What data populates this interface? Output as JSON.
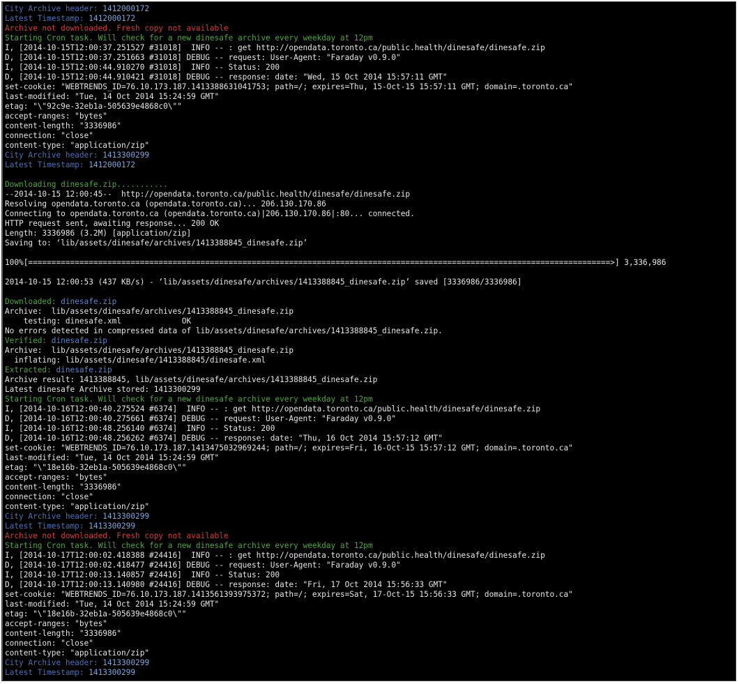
{
  "colors": {
    "background": "#000000",
    "plain": "#e6e6e6",
    "label_blue": "#4a6fb5",
    "value_blue": "#7fa6d9",
    "error_red": "#d23a3a",
    "info_green": "#4ea63b"
  },
  "lines": [
    [
      {
        "t": "City Archive header: ",
        "s": "label"
      },
      {
        "t": "1412000172",
        "s": "val"
      }
    ],
    [
      {
        "t": "Latest Timestamp: ",
        "s": "label"
      },
      {
        "t": "1412000172",
        "s": "val"
      }
    ],
    [
      {
        "t": "Archive not downloaded. Fresh copy not available",
        "s": "err"
      }
    ],
    [
      {
        "t": "Starting Cron task. Will check for a new dinesafe archive every weekday at 12pm",
        "s": "green"
      }
    ],
    [
      {
        "t": "I, [2014-10-15T12:00:37.251527 #31018]  INFO -- : get http://opendata.toronto.ca/public.health/dinesafe/dinesafe.zip",
        "s": "plain"
      }
    ],
    [
      {
        "t": "D, [2014-10-15T12:00:37.251663 #31018] DEBUG -- request: User-Agent: \"Faraday v0.9.0\"",
        "s": "plain"
      }
    ],
    [
      {
        "t": "I, [2014-10-15T12:00:44.910270 #31018]  INFO -- Status: 200",
        "s": "plain"
      }
    ],
    [
      {
        "t": "D, [2014-10-15T12:00:44.910421 #31018] DEBUG -- response: date: \"Wed, 15 Oct 2014 15:57:11 GMT\"",
        "s": "plain"
      }
    ],
    [
      {
        "t": "set-cookie: \"WEBTRENDS_ID=76.10.173.187.1413388631041753; path=/; expires=Thu, 15-Oct-15 15:57:11 GMT; domain=.toronto.ca\"",
        "s": "plain"
      }
    ],
    [
      {
        "t": "last-modified: \"Tue, 14 Oct 2014 15:24:59 GMT\"",
        "s": "plain"
      }
    ],
    [
      {
        "t": "etag: \"\\\"92c9e-32eb1a-505639e4868c0\\\"\"",
        "s": "plain"
      }
    ],
    [
      {
        "t": "accept-ranges: \"bytes\"",
        "s": "plain"
      }
    ],
    [
      {
        "t": "content-length: \"3336986\"",
        "s": "plain"
      }
    ],
    [
      {
        "t": "connection: \"close\"",
        "s": "plain"
      }
    ],
    [
      {
        "t": "content-type: \"application/zip\"",
        "s": "plain"
      }
    ],
    [
      {
        "t": "City Archive header: ",
        "s": "label"
      },
      {
        "t": "1413300299",
        "s": "val"
      }
    ],
    [
      {
        "t": "Latest Timestamp: ",
        "s": "label"
      },
      {
        "t": "1412000172",
        "s": "val"
      }
    ],
    [
      {
        "t": "",
        "s": "plain"
      }
    ],
    [
      {
        "t": "Downloading dinesafe.zip...........",
        "s": "green"
      }
    ],
    [
      {
        "t": "--2014-10-15 12:00:45--  http://opendata.toronto.ca/public.health/dinesafe/dinesafe.zip",
        "s": "plain"
      }
    ],
    [
      {
        "t": "Resolving opendata.toronto.ca (opendata.toronto.ca)... 206.130.170.86",
        "s": "plain"
      }
    ],
    [
      {
        "t": "Connecting to opendata.toronto.ca (opendata.toronto.ca)|206.130.170.86|:80... connected.",
        "s": "plain"
      }
    ],
    [
      {
        "t": "HTTP request sent, awaiting response... 200 OK",
        "s": "plain"
      }
    ],
    [
      {
        "t": "Length: 3336986 (3.2M) [application/zip]",
        "s": "plain"
      }
    ],
    [
      {
        "t": "Saving to: ‘lib/assets/dinesafe/archives/1413388845_dinesafe.zip’",
        "s": "plain"
      }
    ],
    [
      {
        "t": "",
        "s": "plain"
      }
    ],
    [
      {
        "t": "100%[=============================================================================================================================>] 3,336,986",
        "s": "plain"
      }
    ],
    [
      {
        "t": "",
        "s": "plain"
      }
    ],
    [
      {
        "t": "2014-10-15 12:00:53 (437 KB/s) - ‘lib/assets/dinesafe/archives/1413388845_dinesafe.zip’ saved [3336986/3336986]",
        "s": "plain"
      }
    ],
    [
      {
        "t": "",
        "s": "plain"
      }
    ],
    [
      {
        "t": "Downloaded: ",
        "s": "green"
      },
      {
        "t": "dinesafe.zip",
        "s": "file"
      }
    ],
    [
      {
        "t": "Archive:  lib/assets/dinesafe/archives/1413388845_dinesafe.zip",
        "s": "plain"
      }
    ],
    [
      {
        "t": "    testing: dinesafe.xml             OK",
        "s": "plain"
      }
    ],
    [
      {
        "t": "No errors detected in compressed data of lib/assets/dinesafe/archives/1413388845_dinesafe.zip.",
        "s": "plain"
      }
    ],
    [
      {
        "t": "Verified: ",
        "s": "green"
      },
      {
        "t": "dinesafe.zip",
        "s": "file"
      }
    ],
    [
      {
        "t": "Archive:  lib/assets/dinesafe/archives/1413388845_dinesafe.zip",
        "s": "plain"
      }
    ],
    [
      {
        "t": "  inflating: lib/assets/dinesafe/1413388845/dinesafe.xml",
        "s": "plain"
      }
    ],
    [
      {
        "t": "Extracted: ",
        "s": "green"
      },
      {
        "t": "dinesafe.zip",
        "s": "file"
      }
    ],
    [
      {
        "t": "Archive result: 1413388845, lib/assets/dinesafe/archives/1413388845_dinesafe.zip",
        "s": "plain"
      }
    ],
    [
      {
        "t": "Latest dinesafe Archive stored: 1413300299",
        "s": "plain"
      }
    ],
    [
      {
        "t": "Starting Cron task. Will check for a new dinesafe archive every weekday at 12pm",
        "s": "green"
      }
    ],
    [
      {
        "t": "I, [2014-10-16T12:00:40.275524 #6374]  INFO -- : get http://opendata.toronto.ca/public.health/dinesafe/dinesafe.zip",
        "s": "plain"
      }
    ],
    [
      {
        "t": "D, [2014-10-16T12:00:40.275661 #6374] DEBUG -- request: User-Agent: \"Faraday v0.9.0\"",
        "s": "plain"
      }
    ],
    [
      {
        "t": "I, [2014-10-16T12:00:48.256140 #6374]  INFO -- Status: 200",
        "s": "plain"
      }
    ],
    [
      {
        "t": "D, [2014-10-16T12:00:48.256262 #6374] DEBUG -- response: date: \"Thu, 16 Oct 2014 15:57:12 GMT\"",
        "s": "plain"
      }
    ],
    [
      {
        "t": "set-cookie: \"WEBTRENDS_ID=76.10.173.187.1413475032969244; path=/; expires=Fri, 16-Oct-15 15:57:12 GMT; domain=.toronto.ca\"",
        "s": "plain"
      }
    ],
    [
      {
        "t": "last-modified: \"Tue, 14 Oct 2014 15:24:59 GMT\"",
        "s": "plain"
      }
    ],
    [
      {
        "t": "etag: \"\\\"18e16b-32eb1a-505639e4868c0\\\"\"",
        "s": "plain"
      }
    ],
    [
      {
        "t": "accept-ranges: \"bytes\"",
        "s": "plain"
      }
    ],
    [
      {
        "t": "content-length: \"3336986\"",
        "s": "plain"
      }
    ],
    [
      {
        "t": "connection: \"close\"",
        "s": "plain"
      }
    ],
    [
      {
        "t": "content-type: \"application/zip\"",
        "s": "plain"
      }
    ],
    [
      {
        "t": "City Archive header: ",
        "s": "label"
      },
      {
        "t": "1413300299",
        "s": "val"
      }
    ],
    [
      {
        "t": "Latest Timestamp: ",
        "s": "label"
      },
      {
        "t": "1413300299",
        "s": "val"
      }
    ],
    [
      {
        "t": "Archive not downloaded. Fresh copy not available",
        "s": "err"
      }
    ],
    [
      {
        "t": "Starting Cron task. Will check for a new dinesafe archive every weekday at 12pm",
        "s": "green"
      }
    ],
    [
      {
        "t": "I, [2014-10-17T12:00:02.418388 #24416]  INFO -- : get http://opendata.toronto.ca/public.health/dinesafe/dinesafe.zip",
        "s": "plain"
      }
    ],
    [
      {
        "t": "D, [2014-10-17T12:00:02.418477 #24416] DEBUG -- request: User-Agent: \"Faraday v0.9.0\"",
        "s": "plain"
      }
    ],
    [
      {
        "t": "I, [2014-10-17T12:00:13.140857 #24416]  INFO -- Status: 200",
        "s": "plain"
      }
    ],
    [
      {
        "t": "D, [2014-10-17T12:00:13.140980 #24416] DEBUG -- response: date: \"Fri, 17 Oct 2014 15:56:33 GMT\"",
        "s": "plain"
      }
    ],
    [
      {
        "t": "set-cookie: \"WEBTRENDS_ID=76.10.173.187.1413561393975372; path=/; expires=Sat, 17-Oct-15 15:56:33 GMT; domain=.toronto.ca\"",
        "s": "plain"
      }
    ],
    [
      {
        "t": "last-modified: \"Tue, 14 Oct 2014 15:24:59 GMT\"",
        "s": "plain"
      }
    ],
    [
      {
        "t": "etag: \"\\\"18e16b-32eb1a-505639e4868c0\\\"\"",
        "s": "plain"
      }
    ],
    [
      {
        "t": "accept-ranges: \"bytes\"",
        "s": "plain"
      }
    ],
    [
      {
        "t": "content-length: \"3336986\"",
        "s": "plain"
      }
    ],
    [
      {
        "t": "connection: \"close\"",
        "s": "plain"
      }
    ],
    [
      {
        "t": "content-type: \"application/zip\"",
        "s": "plain"
      }
    ],
    [
      {
        "t": "City Archive header: ",
        "s": "label"
      },
      {
        "t": "1413300299",
        "s": "val"
      }
    ],
    [
      {
        "t": "Latest Timestamp: ",
        "s": "label"
      },
      {
        "t": "1413300299",
        "s": "val"
      }
    ]
  ]
}
